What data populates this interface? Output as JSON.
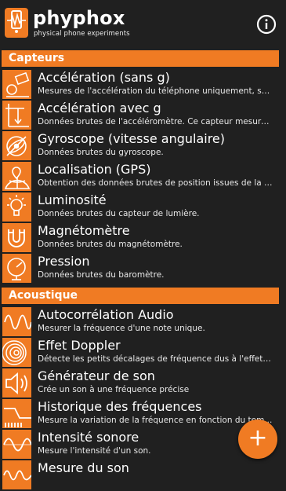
{
  "app": {
    "title": "phyphox",
    "subtitle": "physical phone experiments",
    "brand_color": "#f07b23"
  },
  "sections": [
    {
      "header": "Capteurs",
      "items": [
        {
          "title": "Accélération (sans g)",
          "desc": "Mesures de l'accélération du téléphone uniquement, san...",
          "icon": "acceleration-icon"
        },
        {
          "title": "Accélération avec g",
          "desc": "Données brutes de l'accéléromètre. Ce capteur mesure l...",
          "icon": "acceleration-g-icon"
        },
        {
          "title": "Gyroscope (vitesse angulaire)",
          "desc": "Données brutes du gyroscope.",
          "icon": "gyroscope-icon"
        },
        {
          "title": "Localisation (GPS)",
          "desc": "Obtention des données brutes de position issues de la n...",
          "icon": "gps-icon"
        },
        {
          "title": "Luminosité",
          "desc": "Données brutes du capteur de lumière.",
          "icon": "light-bulb-icon"
        },
        {
          "title": "Magnétomètre",
          "desc": "Données brutes du magnétomètre.",
          "icon": "magnet-icon"
        },
        {
          "title": "Pression",
          "desc": "Données brutes du baromètre.",
          "icon": "barometer-icon"
        }
      ]
    },
    {
      "header": "Acoustique",
      "items": [
        {
          "title": "Autocorrélation Audio",
          "desc": "Mesurer la fréquence d'une note unique.",
          "icon": "autocorrelation-icon"
        },
        {
          "title": "Effet Doppler",
          "desc": "Détecte les petits décalages de fréquence dus à l'effet D...",
          "icon": "doppler-icon"
        },
        {
          "title": "Générateur de son",
          "desc": "Crée un son à une fréquence précise",
          "icon": "speaker-icon"
        },
        {
          "title": "Historique des fréquences",
          "desc": "Mesure la variation de la fréquence en fonction du tem...",
          "icon": "frequency-history-icon"
        },
        {
          "title": "Intensité sonore",
          "desc": "Mesure l'intensité d'un son.",
          "icon": "sound-intensity-icon"
        },
        {
          "title": "Mesure du son",
          "desc": "",
          "icon": "sound-measure-icon"
        }
      ]
    }
  ],
  "fab": {
    "label": "+",
    "icon": "add-icon"
  }
}
